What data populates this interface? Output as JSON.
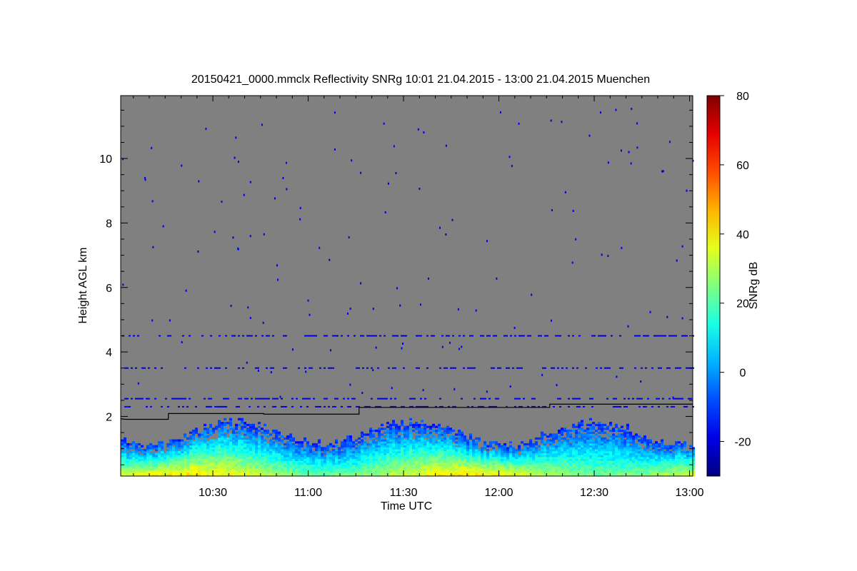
{
  "chart_data": {
    "type": "heatmap",
    "title": "20150421_0000.mmclx Reflectivity SNRg   10:01 21.04.2015 - 13:00 21.04.2015 Muenchen",
    "xlabel": "Time UTC",
    "ylabel": "Height AGL km",
    "colorbar_label": "SNRg dB",
    "x_unit": "minutes of day (UTC)",
    "xlim": [
      601,
      781
    ],
    "x_ticks": [
      {
        "value": 630,
        "label": "10:30"
      },
      {
        "value": 660,
        "label": "11:00"
      },
      {
        "value": 690,
        "label": "11:30"
      },
      {
        "value": 720,
        "label": "12:00"
      },
      {
        "value": 750,
        "label": "12:30"
      },
      {
        "value": 780,
        "label": "13:00"
      }
    ],
    "ylim": [
      0.15,
      11.95
    ],
    "y_ticks": [
      2,
      4,
      6,
      8,
      10
    ],
    "colorbar_range": [
      -30,
      80
    ],
    "colorbar_ticks": [
      -20,
      0,
      20,
      40,
      60,
      80
    ],
    "colormap": "jet",
    "background_color": "#808080",
    "line_series": {
      "color": "#000000",
      "points": [
        [
          601,
          1.93
        ],
        [
          602.5,
          1.91
        ],
        [
          616,
          1.91
        ],
        [
          616,
          2.09
        ],
        [
          646,
          2.09
        ],
        [
          646,
          2.07
        ],
        [
          661,
          2.07
        ],
        [
          676,
          2.07
        ],
        [
          676,
          2.28
        ],
        [
          736,
          2.28
        ],
        [
          736,
          2.38
        ],
        [
          781,
          2.38
        ]
      ]
    },
    "echo_layers": [
      {
        "height_km": 2.3,
        "snr_db": -18
      },
      {
        "height_km": 2.55,
        "snr_db": -20
      },
      {
        "height_km": 3.5,
        "snr_db": -20
      },
      {
        "height_km": 4.5,
        "snr_db": -20
      }
    ],
    "boundary_layer": {
      "top_km": 1.7,
      "max_snr_db": 42
    }
  }
}
